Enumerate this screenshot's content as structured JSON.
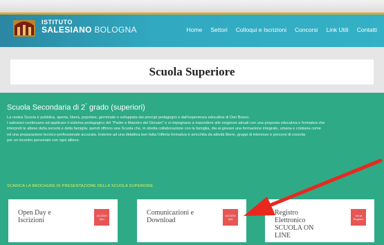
{
  "header": {
    "brand_line1": "ISTITUTO",
    "brand_line2a": "SALESIANO",
    "brand_line2b": "BOLOGNA",
    "nav": [
      "Home",
      "Settori",
      "Colloqui e Iscrizioni",
      "Concorsi",
      "Link Utili",
      "Contatti"
    ]
  },
  "page_title": "Scuola Superiore",
  "section": {
    "heading_pre": "Scuola Secondaria di 2",
    "heading_sup": "°",
    "heading_post": " grado (superiori)",
    "lines": [
      "La nostra Scuola è pubblica, aperta, libera, popolare, germinale e sviluppata dai principi pedagogici e dall'esperienza educativa di Don Bosco.",
      "I salesiani continuano ad applicare il sistema pedagogico del \"Padre e Maestro dei Giovani\" e si impegnano a rispondere alle esigenze attuali con una proposta educativa e formativa che",
      "interpreti le attese della società e della famiglia: quindi offrono una Scuola che, in stretta collaborazione con la famiglia, dia ai giovani una formazione integrale, umana e cristiana come",
      "ed una preparazione tecnico-professionale accurata. Insieme ad una didattica ben fatta l'offerta formativa è arricchita da attività libere, gruppi di interesse e percorsi di crescita",
      "per un incontro personale con ogni allievo."
    ],
    "brochure_link": "SCARICA LA BROCHURE DI PRESENTAZIONE DELLA SCUOLA SUPERIORE"
  },
  "cards": [
    {
      "label": "Open Day e Iscrizioni",
      "button": "ACCEDI QUI"
    },
    {
      "label": "Comunicazioni e Download",
      "button": "ACCEDI QUI"
    },
    {
      "label": "Registro Elettronico SCUOLA ON LINE",
      "button": "Vai al Registro"
    }
  ],
  "colors": {
    "nav_bar": "#31a9c0",
    "section_green": "#2eaa86",
    "card_button": "#e85555",
    "arrow": "#e8281f"
  },
  "icons": {
    "logo": "institute-logo-icon",
    "arrow": "red-arrow-annotation"
  }
}
